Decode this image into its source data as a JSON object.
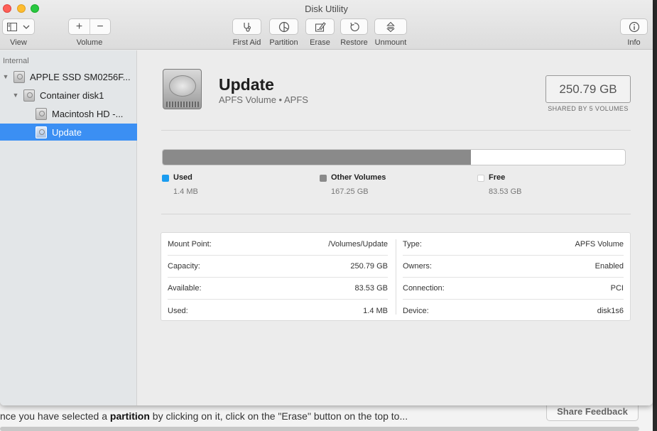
{
  "window": {
    "title": "Disk Utility"
  },
  "toolbar": {
    "view": {
      "label": "View"
    },
    "volume": {
      "label": "Volume",
      "add": "+",
      "remove": "−"
    },
    "first_aid": {
      "label": "First Aid"
    },
    "partition": {
      "label": "Partition"
    },
    "erase": {
      "label": "Erase"
    },
    "restore": {
      "label": "Restore"
    },
    "unmount": {
      "label": "Unmount"
    },
    "info": {
      "label": "Info"
    }
  },
  "sidebar": {
    "section": "Internal",
    "items": [
      {
        "label": "APPLE SSD SM0256F...",
        "level": 0
      },
      {
        "label": "Container disk1",
        "level": 1
      },
      {
        "label": "Macintosh HD -...",
        "level": 2
      },
      {
        "label": "Update",
        "level": 2,
        "selected": true
      }
    ]
  },
  "volume": {
    "name": "Update",
    "subtitle": "APFS Volume • APFS",
    "capacity": "250.79 GB",
    "shared_note": "SHARED BY 5 VOLUMES"
  },
  "usage": {
    "used_fraction": 0.667,
    "legend": [
      {
        "name": "Used",
        "value": "1.4 MB",
        "color": "#1a9cf0"
      },
      {
        "name": "Other Volumes",
        "value": "167.25 GB",
        "color": "#8a8a8a"
      },
      {
        "name": "Free",
        "value": "83.53 GB",
        "color": "#ffffff"
      }
    ]
  },
  "info": {
    "left": [
      {
        "key": "Mount Point:",
        "value": "/Volumes/Update"
      },
      {
        "key": "Capacity:",
        "value": "250.79 GB"
      },
      {
        "key": "Available:",
        "value": "83.53 GB"
      },
      {
        "key": "Used:",
        "value": "1.4 MB"
      }
    ],
    "right": [
      {
        "key": "Type:",
        "value": "APFS Volume"
      },
      {
        "key": "Owners:",
        "value": "Enabled"
      },
      {
        "key": "Connection:",
        "value": "PCI"
      },
      {
        "key": "Device:",
        "value": "disk1s6"
      }
    ]
  },
  "background_page": {
    "text_before": "nce you have selected a ",
    "text_bold": "partition",
    "text_after": " by clicking on it, click on the \"Erase\" button on the top to...",
    "share_button": "Share Feedback"
  }
}
